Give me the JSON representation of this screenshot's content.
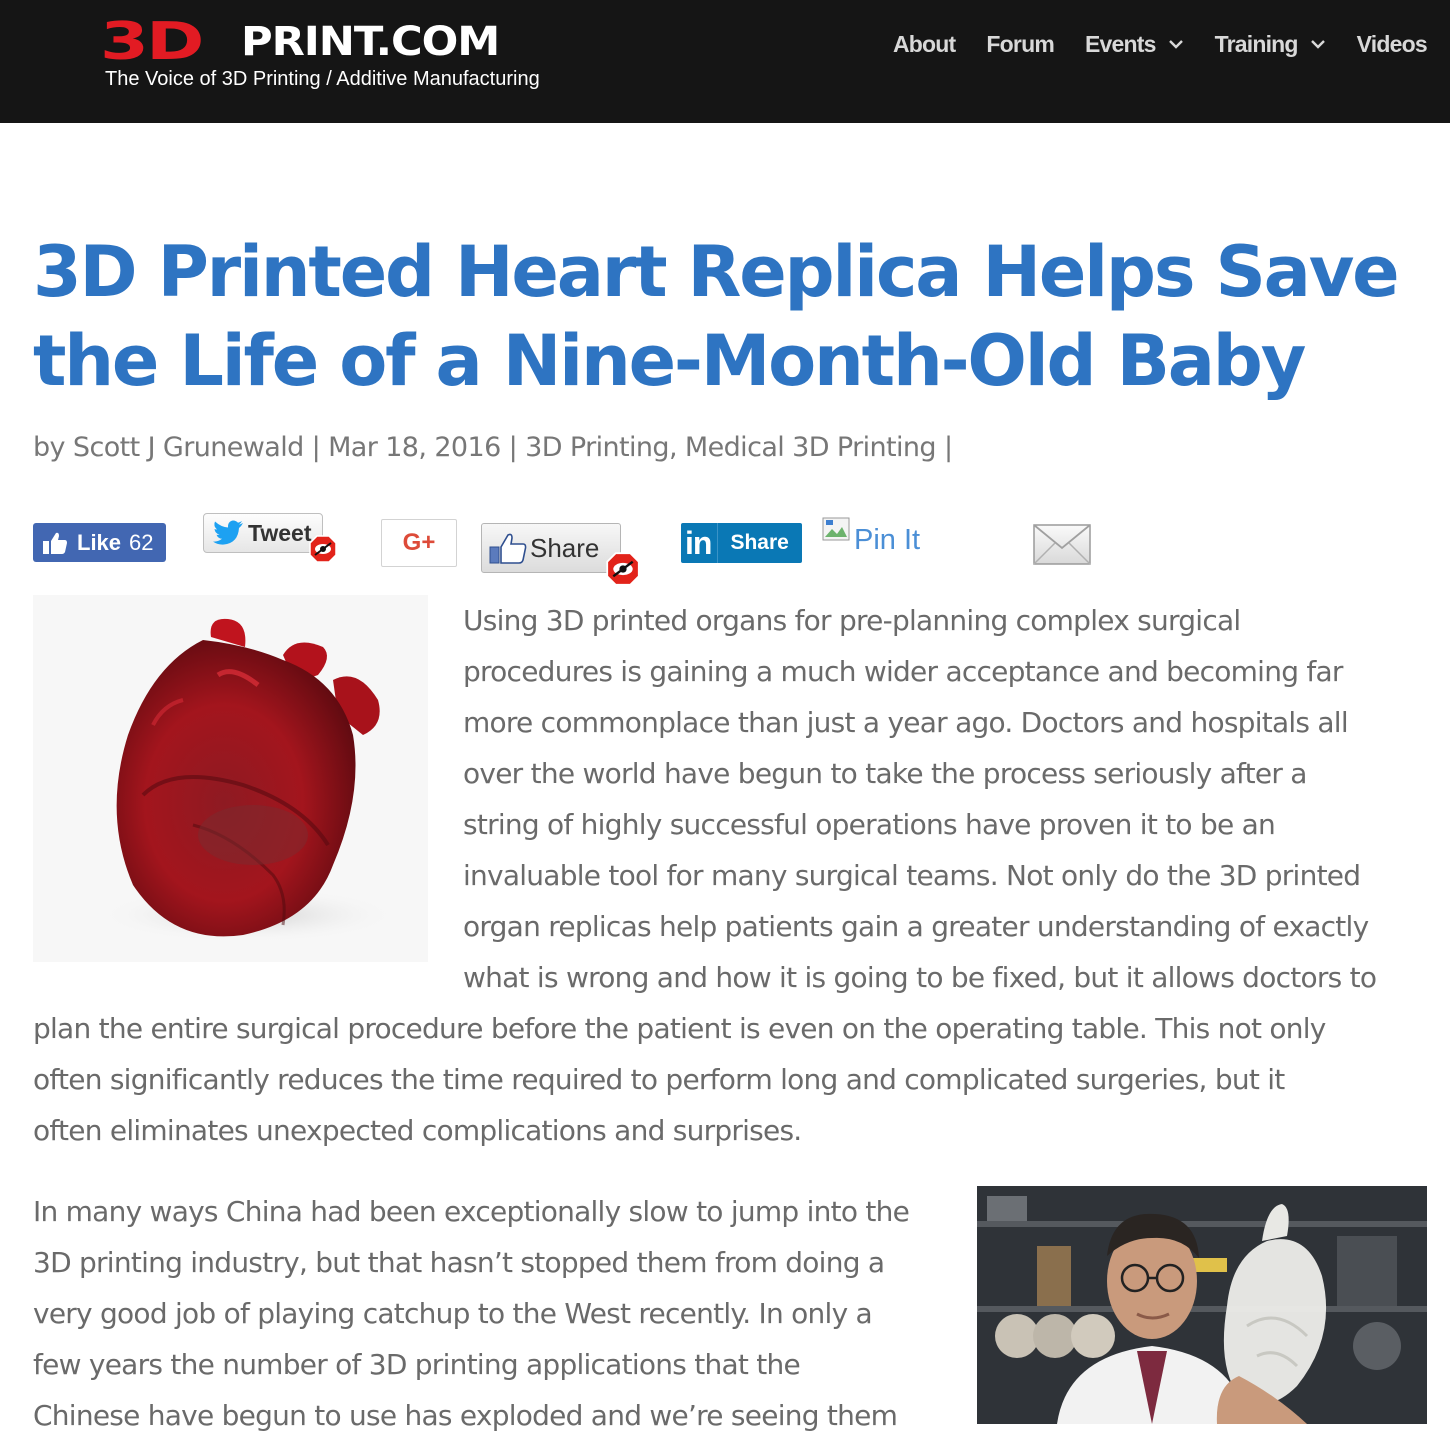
{
  "header": {
    "logo_mark": "3D",
    "logo_text": "PRINT.COM",
    "tagline": "The Voice of 3D Printing / Additive Manufacturing",
    "nav": [
      {
        "label": "About",
        "dropdown": false
      },
      {
        "label": "Forum",
        "dropdown": false
      },
      {
        "label": "Events",
        "dropdown": true
      },
      {
        "label": "Training",
        "dropdown": true
      },
      {
        "label": "Videos",
        "dropdown": false
      }
    ]
  },
  "article": {
    "title": "3D Printed Heart Replica Helps Save the Life of a Nine-Month-Old Baby",
    "meta": {
      "by": "by",
      "author": "Scott J Grunewald",
      "sep": "|",
      "date": "Mar 18, 2016",
      "cat1": "3D Printing",
      "comma": ",",
      "cat2": "Medical 3D Printing"
    },
    "share": {
      "fb_like": "Like",
      "fb_like_count": "62",
      "tweet": "Tweet",
      "gplus": "G+",
      "fb_share": "Share",
      "linkedin_in": "in",
      "linkedin_share": "Share",
      "pin": "Pin It"
    },
    "paragraph1_lines": [
      "Using 3D printed organs for pre-planning complex surgical",
      "procedures is gaining a much wider acceptance and becoming far",
      "more commonplace than just a year ago. Doctors and hospitals all",
      "over the world have begun to take the process seriously after a",
      "string of highly successful operations have proven it to be an",
      "invaluable tool for many surgical teams. Not only do the 3D printed",
      "organ replicas help patients gain a greater understanding of exactly",
      "what is wrong and how it is going to be fixed, but it allows doctors to",
      "plan the entire surgical procedure before the patient is even on the operating table. This not only",
      "often significantly reduces the time required to perform long and complicated surgeries, but it",
      "often eliminates unexpected complications and surprises."
    ],
    "paragraph2_lines": [
      "In many ways China had been exceptionally slow to jump into the",
      "3D printing industry, but that hasn’t stopped them from doing a",
      "very good job of playing catchup to the West recently. In only a",
      "few years the number of 3D printing applications that the",
      "Chinese have begun to use has exploded and we’re seeing them"
    ]
  },
  "colors": {
    "header_bg": "#151515",
    "logo_red": "#e21b23",
    "title_blue": "#2e74c2",
    "body_text": "#6a6a6a",
    "facebook": "#4267b2",
    "linkedin": "#0a78b5"
  }
}
